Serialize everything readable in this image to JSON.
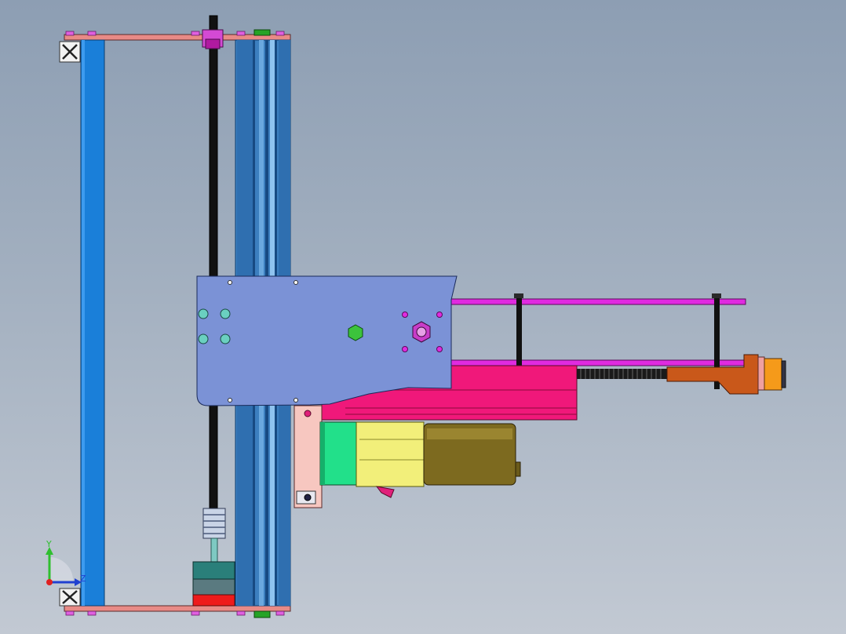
{
  "window": {
    "type": "cad-3d-viewport",
    "background_gradient": [
      "#8d9eb3",
      "#c2c9d3"
    ]
  },
  "triad": {
    "y_label": "Y",
    "z_label": "Z",
    "x_label": ""
  },
  "colors": {
    "frame_blue": "#1a7fd9",
    "rail_blue": "#3c7fbf",
    "plate_periwinkle": "#7b92d6",
    "magenta": "#e02be0",
    "hot_pink": "#f0187a",
    "motor_yellow": "#f2ef7a",
    "motor_olive": "#7d6a1f",
    "mint_green": "#22e08a",
    "salmon": "#e88a86",
    "rust": "#c9581a",
    "orange": "#f59a1a",
    "stepper_red": "#ee1b1b",
    "stepper_teal": "#2a7f7a",
    "leadscrew_black": "#111111"
  },
  "parts": [
    {
      "name": "left-vertical-extrusion",
      "color": "frame_blue"
    },
    {
      "name": "lead-screw",
      "color": "leadscrew_black"
    },
    {
      "name": "linear-rail",
      "color": "rail_blue"
    },
    {
      "name": "carriage-plate",
      "color": "plate_periwinkle"
    },
    {
      "name": "spindle-motor",
      "color": "motor_yellow"
    },
    {
      "name": "stepper-motor",
      "color": "stepper_red"
    },
    {
      "name": "horizontal-arm",
      "color": "magenta"
    },
    {
      "name": "threaded-rod",
      "color": "leadscrew_black"
    },
    {
      "name": "end-bracket",
      "color": "rust"
    }
  ]
}
